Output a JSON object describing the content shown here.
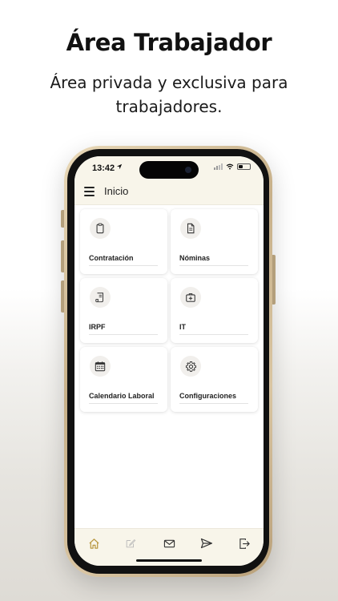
{
  "promo": {
    "headline": "Área Trabajador",
    "subline": "Área privada y exclusiva para trabajadores."
  },
  "status_bar": {
    "time": "13:42",
    "location_icon": "location-arrow-icon",
    "signal_icon": "cellular-signal-icon",
    "wifi_icon": "wifi-icon",
    "battery_icon": "battery-icon",
    "battery_level": 0.35
  },
  "app_bar": {
    "menu_icon": "hamburger-menu-icon",
    "title": "Inicio"
  },
  "cards": [
    {
      "label": "Contratación",
      "icon": "clipboard-icon"
    },
    {
      "label": "Nóminas",
      "icon": "document-icon"
    },
    {
      "label": "IRPF",
      "icon": "receipt-scroll-icon"
    },
    {
      "label": "IT",
      "icon": "medical-kit-icon"
    },
    {
      "label": "Calendario Laboral",
      "icon": "calendar-icon"
    },
    {
      "label": "Configuraciones",
      "icon": "gear-icon"
    }
  ],
  "bottom_nav": [
    {
      "icon": "home-icon",
      "active": true
    },
    {
      "icon": "edit-note-icon",
      "active": false
    },
    {
      "icon": "mail-icon",
      "active": false
    },
    {
      "icon": "send-icon",
      "active": false
    },
    {
      "icon": "logout-icon",
      "active": false
    }
  ],
  "colors": {
    "bar_background": "#f8f5ea",
    "active_nav": "#b8973f",
    "inactive_nav": "#333333",
    "phone_frame": "#c7b089"
  }
}
